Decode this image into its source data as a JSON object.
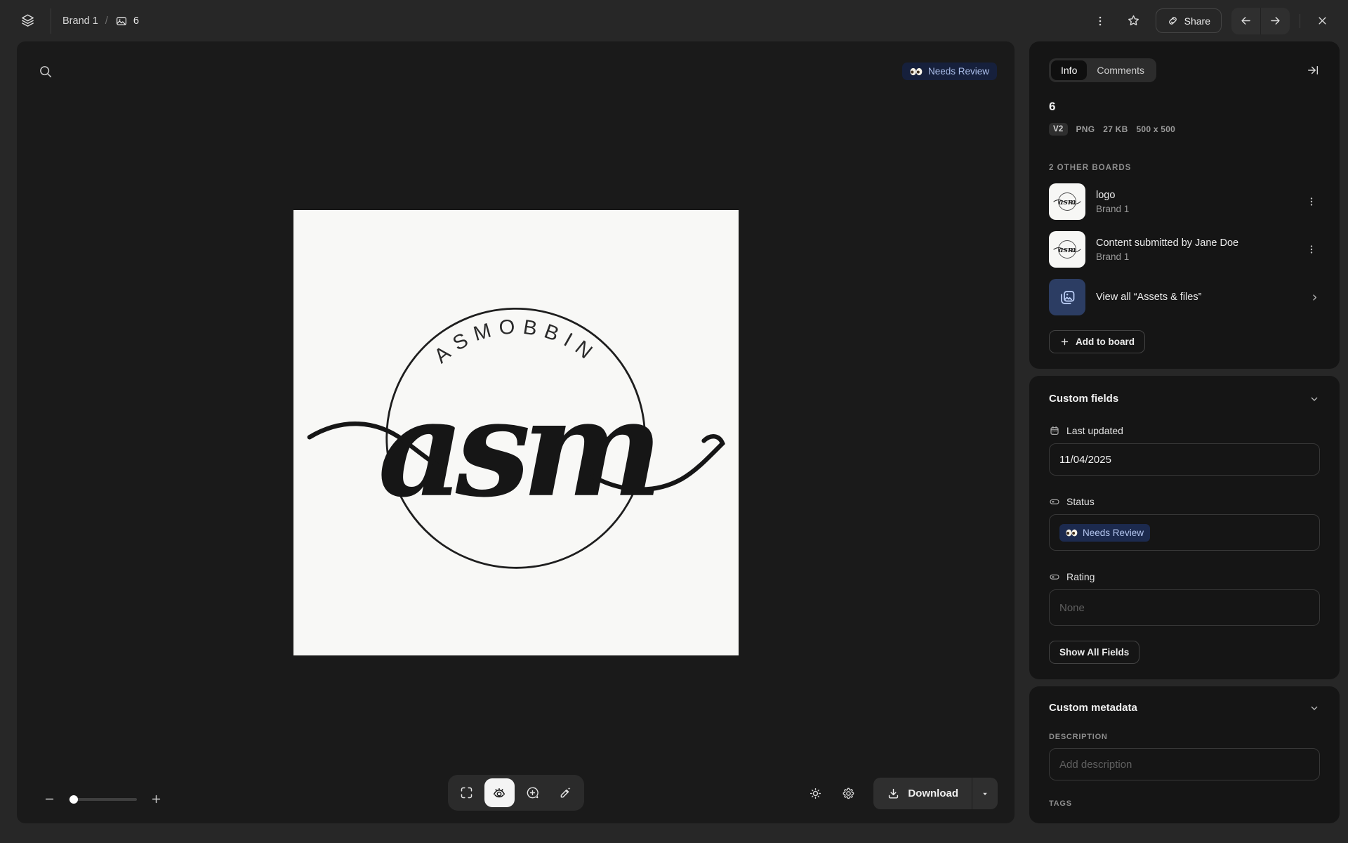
{
  "topbar": {
    "breadcrumb": {
      "board": "Brand 1",
      "separator": "/",
      "asset": "6"
    },
    "share_label": "Share"
  },
  "canvas": {
    "status_badge": "Needs Review",
    "logo": {
      "arc_text": "ASMOBBIN",
      "script_text": "asm"
    }
  },
  "bottom_toolbar": {
    "download_label": "Download"
  },
  "sidebar": {
    "tabs": {
      "info": "Info",
      "comments": "Comments"
    },
    "title": "6",
    "meta": {
      "version": "V2",
      "format": "PNG",
      "filesize": "27 KB",
      "dimensions": "500 x 500"
    },
    "boards": {
      "header": "2 OTHER BOARDS",
      "items": [
        {
          "title": "logo",
          "subtitle": "Brand 1"
        },
        {
          "title": "Content submitted by Jane Doe",
          "subtitle": "Brand 1"
        }
      ],
      "view_all": "View all “Assets & files”",
      "add_button": "Add to board"
    },
    "custom_fields": {
      "header": "Custom fields",
      "last_updated_label": "Last updated",
      "last_updated_value": "11/04/2025",
      "status_label": "Status",
      "status_value": "Needs Review",
      "rating_label": "Rating",
      "rating_placeholder": "None",
      "show_all_button": "Show All Fields"
    },
    "custom_metadata": {
      "header": "Custom metadata",
      "description_label": "DESCRIPTION",
      "description_placeholder": "Add description",
      "tags_label": "TAGS"
    }
  },
  "colors": {
    "page_bg": "#272727",
    "canvas_bg": "#1a1a1a",
    "panel_bg": "#151515",
    "badge_bg": "#1c2a4e",
    "badge_text": "#b4c6f0",
    "canvas_badge_bg": "#16203c",
    "canvas_badge_text": "#a9bce8",
    "view_all_tile_bg": "#2c3d63"
  }
}
